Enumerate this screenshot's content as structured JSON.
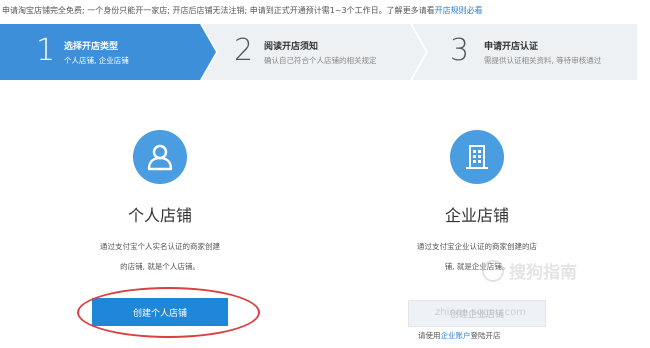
{
  "notice": {
    "text": "申请淘宝店铺完全免费; 一个身份只能开一家店; 开店后店铺无法注销; 申请到正式开通预计需1~3个工作日。了解更多请看",
    "link": "开店规则必看"
  },
  "steps": [
    {
      "number": "1",
      "title": "选择开店类型",
      "desc": "个人店铺, 企业店铺",
      "active": true
    },
    {
      "number": "2",
      "title": "阅读开店须知",
      "desc": "确认自己符合个人店铺的相关规定",
      "active": false
    },
    {
      "number": "3",
      "title": "申请开店认证",
      "desc": "需提供认证相关资料, 等待审核通过",
      "active": false
    }
  ],
  "personal": {
    "icon": "person-icon",
    "title": "个人店铺",
    "desc_line1": "通过支付宝个人实名认证的商家创建",
    "desc_line2": "的店铺, 就是个人店铺。",
    "button": "创建个人店铺"
  },
  "enterprise": {
    "icon": "building-icon",
    "title": "企业店铺",
    "desc_line1": "通过支付宝企业认证的商家创建的店",
    "desc_line2": "铺, 就是企业店铺。",
    "button": "创建企业店铺",
    "hint_prefix": "请使用",
    "hint_link": "企业账户",
    "hint_suffix": "登陆开店"
  },
  "watermark": {
    "text": "搜狗指南",
    "overlay": "zhinan.sogou.com"
  },
  "colors": {
    "active_step": "#3d8fd9",
    "inactive_step": "#eef1f4",
    "primary_button": "#1e87d8",
    "icon_circle": "#4a9de0",
    "highlight": "#d94040"
  }
}
